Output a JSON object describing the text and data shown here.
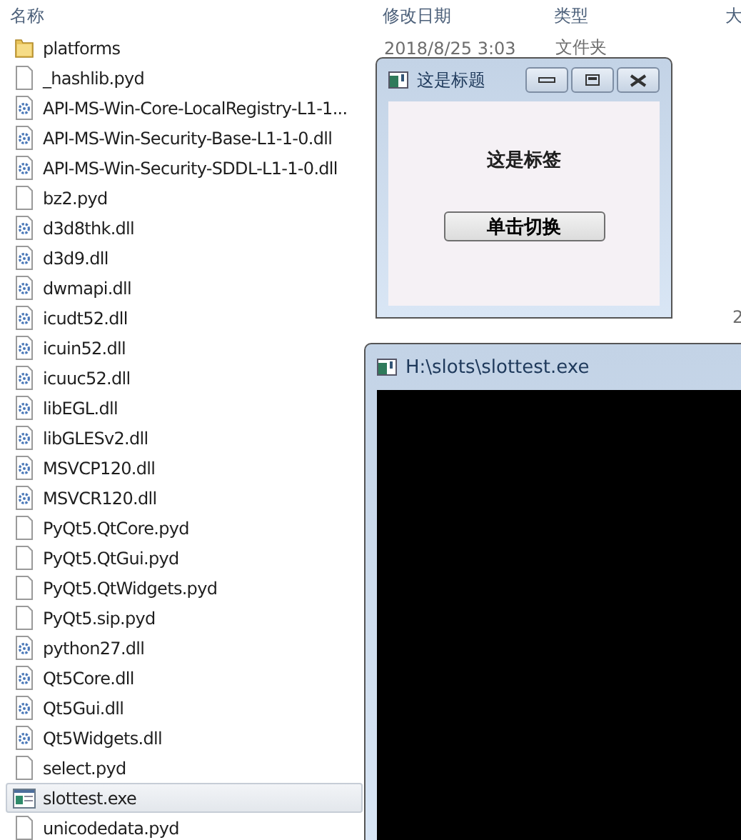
{
  "columns": [
    {
      "label": "名称"
    },
    {
      "label": "修改日期"
    },
    {
      "label": "类型"
    },
    {
      "label": "大"
    }
  ],
  "files": [
    {
      "name": "platforms",
      "kind": "folder",
      "selected": false,
      "date": "2018/8/25 3:03",
      "type": "文件夹"
    },
    {
      "name": "_hashlib.pyd",
      "kind": "file",
      "selected": false
    },
    {
      "name": "API-MS-Win-Core-LocalRegistry-L1-1...",
      "kind": "dll",
      "selected": false
    },
    {
      "name": "API-MS-Win-Security-Base-L1-1-0.dll",
      "kind": "dll",
      "selected": false
    },
    {
      "name": "API-MS-Win-Security-SDDL-L1-1-0.dll",
      "kind": "dll",
      "selected": false
    },
    {
      "name": "bz2.pyd",
      "kind": "file",
      "selected": false
    },
    {
      "name": "d3d8thk.dll",
      "kind": "dll",
      "selected": false
    },
    {
      "name": "d3d9.dll",
      "kind": "dll",
      "selected": false
    },
    {
      "name": "dwmapi.dll",
      "kind": "dll",
      "selected": false
    },
    {
      "name": "icudt52.dll",
      "kind": "dll",
      "selected": false,
      "size": "2"
    },
    {
      "name": "icuin52.dll",
      "kind": "dll",
      "selected": false
    },
    {
      "name": "icuuc52.dll",
      "kind": "dll",
      "selected": false
    },
    {
      "name": "libEGL.dll",
      "kind": "dll",
      "selected": false
    },
    {
      "name": "libGLESv2.dll",
      "kind": "dll",
      "selected": false
    },
    {
      "name": "MSVCP120.dll",
      "kind": "dll",
      "selected": false
    },
    {
      "name": "MSVCR120.dll",
      "kind": "dll",
      "selected": false
    },
    {
      "name": "PyQt5.QtCore.pyd",
      "kind": "file",
      "selected": false
    },
    {
      "name": "PyQt5.QtGui.pyd",
      "kind": "file",
      "selected": false
    },
    {
      "name": "PyQt5.QtWidgets.pyd",
      "kind": "file",
      "selected": false
    },
    {
      "name": "PyQt5.sip.pyd",
      "kind": "file",
      "selected": false
    },
    {
      "name": "python27.dll",
      "kind": "dll",
      "selected": false
    },
    {
      "name": "Qt5Core.dll",
      "kind": "dll",
      "selected": false
    },
    {
      "name": "Qt5Gui.dll",
      "kind": "dll",
      "selected": false
    },
    {
      "name": "Qt5Widgets.dll",
      "kind": "dll",
      "selected": false
    },
    {
      "name": "select.pyd",
      "kind": "file",
      "selected": false
    },
    {
      "name": "slottest.exe",
      "kind": "exe",
      "selected": true
    },
    {
      "name": "unicodedata.pyd",
      "kind": "file",
      "selected": false
    }
  ],
  "qt_window": {
    "title": "这是标题",
    "label": "这是标签",
    "button": "单击切换"
  },
  "console_window": {
    "title": "H:\\slots\\slottest.exe"
  }
}
